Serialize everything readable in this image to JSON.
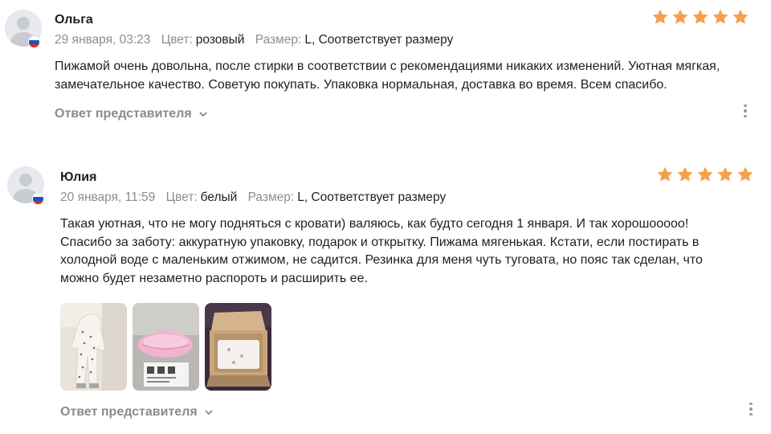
{
  "reviews": [
    {
      "author": "Ольга",
      "date": "29 января, 03:23",
      "color_label": "Цвет:",
      "color_value": "розовый",
      "size_label": "Размер:",
      "size_value": "L, Соответствует размеру",
      "rating": 5,
      "text": "Пижамой очень довольна, после стирки в соответствии с рекомендациями никаких изменений. Уютная мягкая, замечательное качество. Советую покупать. Упаковка нормальная, доставка во время. Всем спасибо.",
      "reply_label": "Ответ представителя",
      "country_flag": "russia-flag-icon"
    },
    {
      "author": "Юлия",
      "date": "20 января, 11:59",
      "color_label": "Цвет:",
      "color_value": "белый",
      "size_label": "Размер:",
      "size_value": "L, Соответствует размеру",
      "rating": 5,
      "text": "Такая уютная, что не могу подняться с кровати) валяюсь, как будто сегодня 1 января. И так хорошооооо! Спасибо за заботу: аккуратную упаковку, подарок и открытку. Пижама мягенькая. Кстати, если постирать в холодной воде с маленьким отжимом, не садится. Резинка для меня чуть туговата, но пояс так сделан, что можно будет незаметно распороть и расширить ее.",
      "photos": [
        "photo-pajamas-worn",
        "photo-pink-pillow-package",
        "photo-opened-box"
      ],
      "reply_label": "Ответ представителя",
      "country_flag": "russia-flag-icon"
    }
  ],
  "colors": {
    "star": "#f6a04d",
    "muted": "#8c8c96",
    "text": "#1f1f1f"
  }
}
